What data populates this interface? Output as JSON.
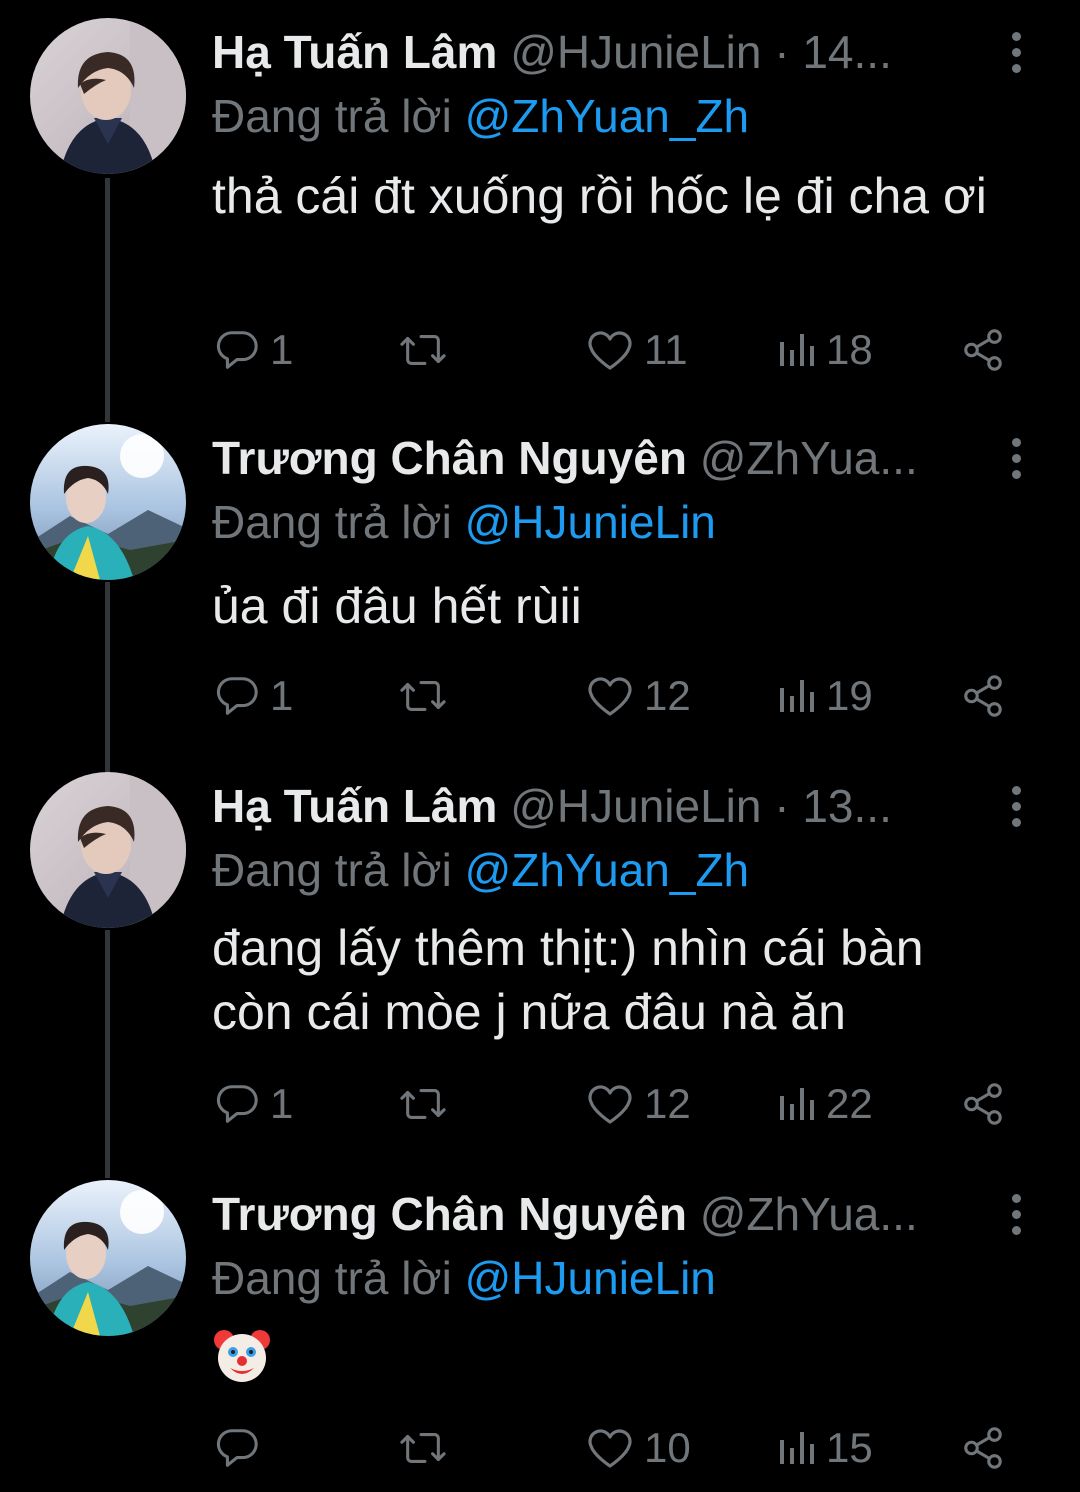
{
  "colors": {
    "background": "#000000",
    "text_primary": "#e7e9ea",
    "text_secondary": "#71767b",
    "accent": "#1d9bf0",
    "thread_line": "#333639"
  },
  "tweets": [
    {
      "display_name": "Hạ Tuấn Lâm",
      "handle_meta": "@HJunieLin · 14...",
      "reply_prefix": "Đang trả lời ",
      "reply_to": "@ZhYuan_Zh",
      "text": "thả cái đt xuống rồi hốc lẹ đi cha ơi",
      "emoji": "",
      "replies": "1",
      "retweets": "",
      "likes": "11",
      "views": "18",
      "avatar_icon": "avatar-hjunielin"
    },
    {
      "display_name": "Trương Chân Nguyên",
      "handle_meta": "@ZhYua...",
      "reply_prefix": "Đang trả lời ",
      "reply_to": "@HJunieLin",
      "text": "ủa đi đâu hết rùii",
      "emoji": "",
      "replies": "1",
      "retweets": "",
      "likes": "12",
      "views": "19",
      "avatar_icon": "avatar-zhyuan"
    },
    {
      "display_name": "Hạ Tuấn Lâm",
      "handle_meta": "@HJunieLin · 13...",
      "reply_prefix": "Đang trả lời ",
      "reply_to": "@ZhYuan_Zh",
      "text": "đang lấy thêm thịt:) nhìn cái bàn còn cái mòe j nữa đâu nà ăn",
      "emoji": "",
      "replies": "1",
      "retweets": "",
      "likes": "12",
      "views": "22",
      "avatar_icon": "avatar-hjunielin"
    },
    {
      "display_name": "Trương Chân Nguyên",
      "handle_meta": "@ZhYua...",
      "reply_prefix": "Đang trả lời ",
      "reply_to": "@HJunieLin",
      "text": "",
      "emoji": "clown-face",
      "replies": "",
      "retweets": "",
      "likes": "10",
      "views": "15",
      "avatar_icon": "avatar-zhyuan"
    }
  ]
}
